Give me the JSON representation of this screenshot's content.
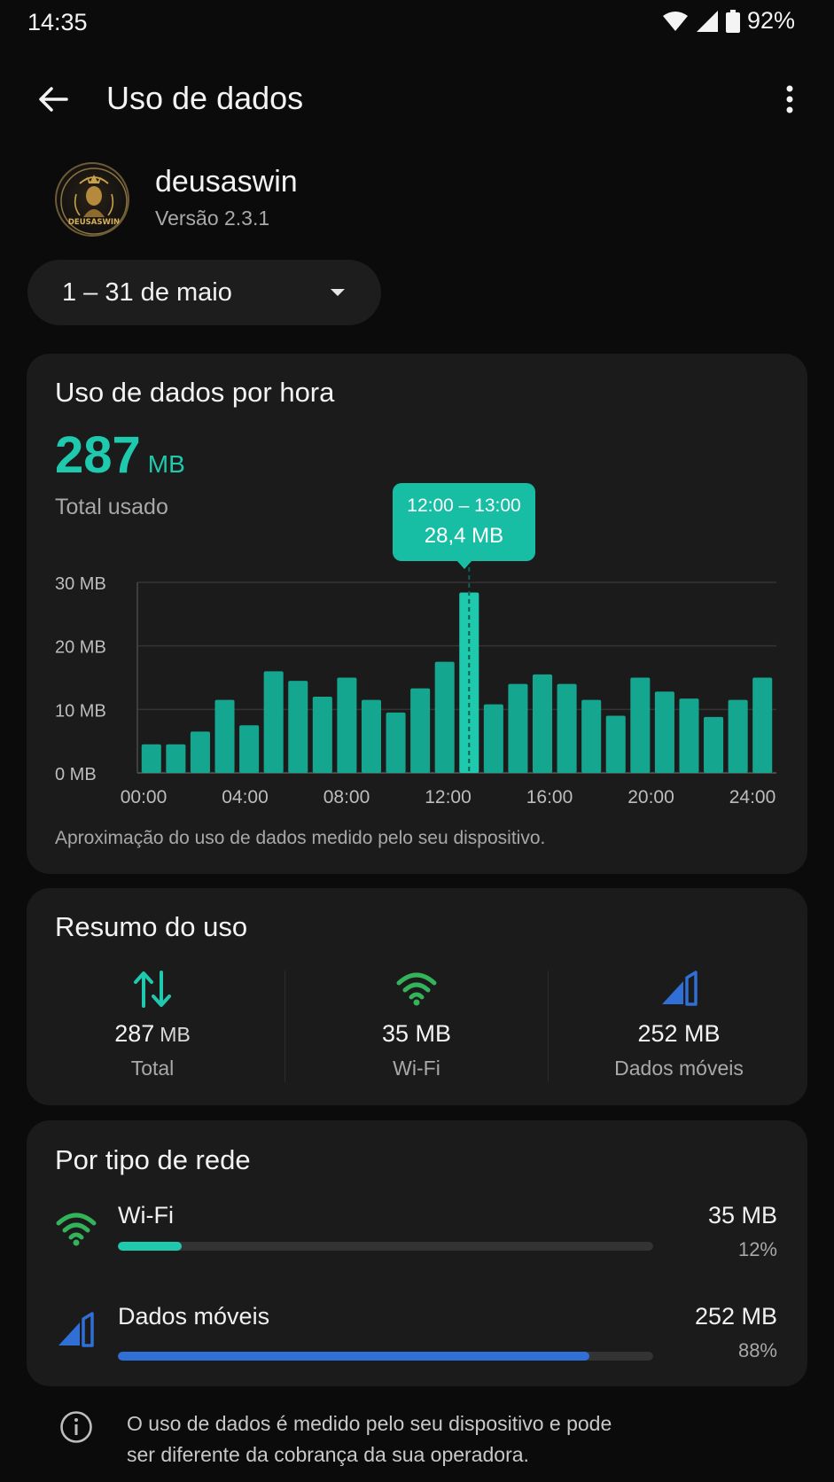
{
  "status": {
    "time": "14:35",
    "battery": "92%"
  },
  "appbar": {
    "title": "Uso de dados",
    "back_icon": "arrow-back-icon",
    "more_icon": "more-vert-icon"
  },
  "app": {
    "name": "deusaswin",
    "version": "Versão 2.3.1",
    "logo_text": "DEUSASWIN"
  },
  "period": {
    "label": "1 – 31 de maio"
  },
  "hourly": {
    "title": "Uso de dados por hora",
    "total_value": "287",
    "total_unit": "MB",
    "total_label": "Total usado",
    "tooltip_range": "12:00 – 13:00",
    "tooltip_value": "28,4 MB",
    "footnote": "Aproximação do uso de dados medido pelo seu dispositivo."
  },
  "chart_data": {
    "type": "bar",
    "y_ticks": [
      "0 MB",
      "10 MB",
      "20 MB",
      "30 MB"
    ],
    "x_ticks": [
      "00:00",
      "04:00",
      "08:00",
      "12:00",
      "16:00",
      "20:00",
      "24:00"
    ],
    "ylim": [
      0,
      30
    ],
    "grid": true,
    "values": [
      4.5,
      4.5,
      6.5,
      11.5,
      7.5,
      16,
      14.5,
      12,
      15,
      11.5,
      9.5,
      13.3,
      17.5,
      28.4,
      10.8,
      14,
      15.5,
      14,
      11.5,
      9,
      15,
      12.8,
      11.7,
      8.8,
      11.5,
      15
    ],
    "highlight_index": 13,
    "bar_color": "#14a68f",
    "highlight_color": "#1fc9ad"
  },
  "summary": {
    "title": "Resumo do uso",
    "items": [
      {
        "icon": "swap-vertical-icon",
        "value": "287",
        "unit": "MB",
        "label": "Total",
        "color": "#1fc9ad"
      },
      {
        "icon": "wifi-icon",
        "value": "35 MB",
        "label": "Wi-Fi",
        "color": "#33b35a"
      },
      {
        "icon": "cellular-signal-icon",
        "value": "252 MB",
        "label": "Dados móveis",
        "color": "#2f6fd6"
      }
    ]
  },
  "network": {
    "title": "Por tipo de rede",
    "items": [
      {
        "name": "Wi-Fi",
        "value": "35 MB",
        "percent": "12%",
        "fraction": 0.12,
        "color": "#1fc9ad",
        "icon_color": "#33b35a"
      },
      {
        "name": "Dados móveis",
        "value": "252 MB",
        "percent": "88%",
        "fraction": 0.88,
        "color": "#2f6fd6",
        "icon_color": "#2f6fd6"
      }
    ]
  },
  "info": {
    "text_line1": "O uso de dados é medido pelo seu dispositivo e pode",
    "text_line2": "ser diferente da cobrança da sua operadora."
  }
}
